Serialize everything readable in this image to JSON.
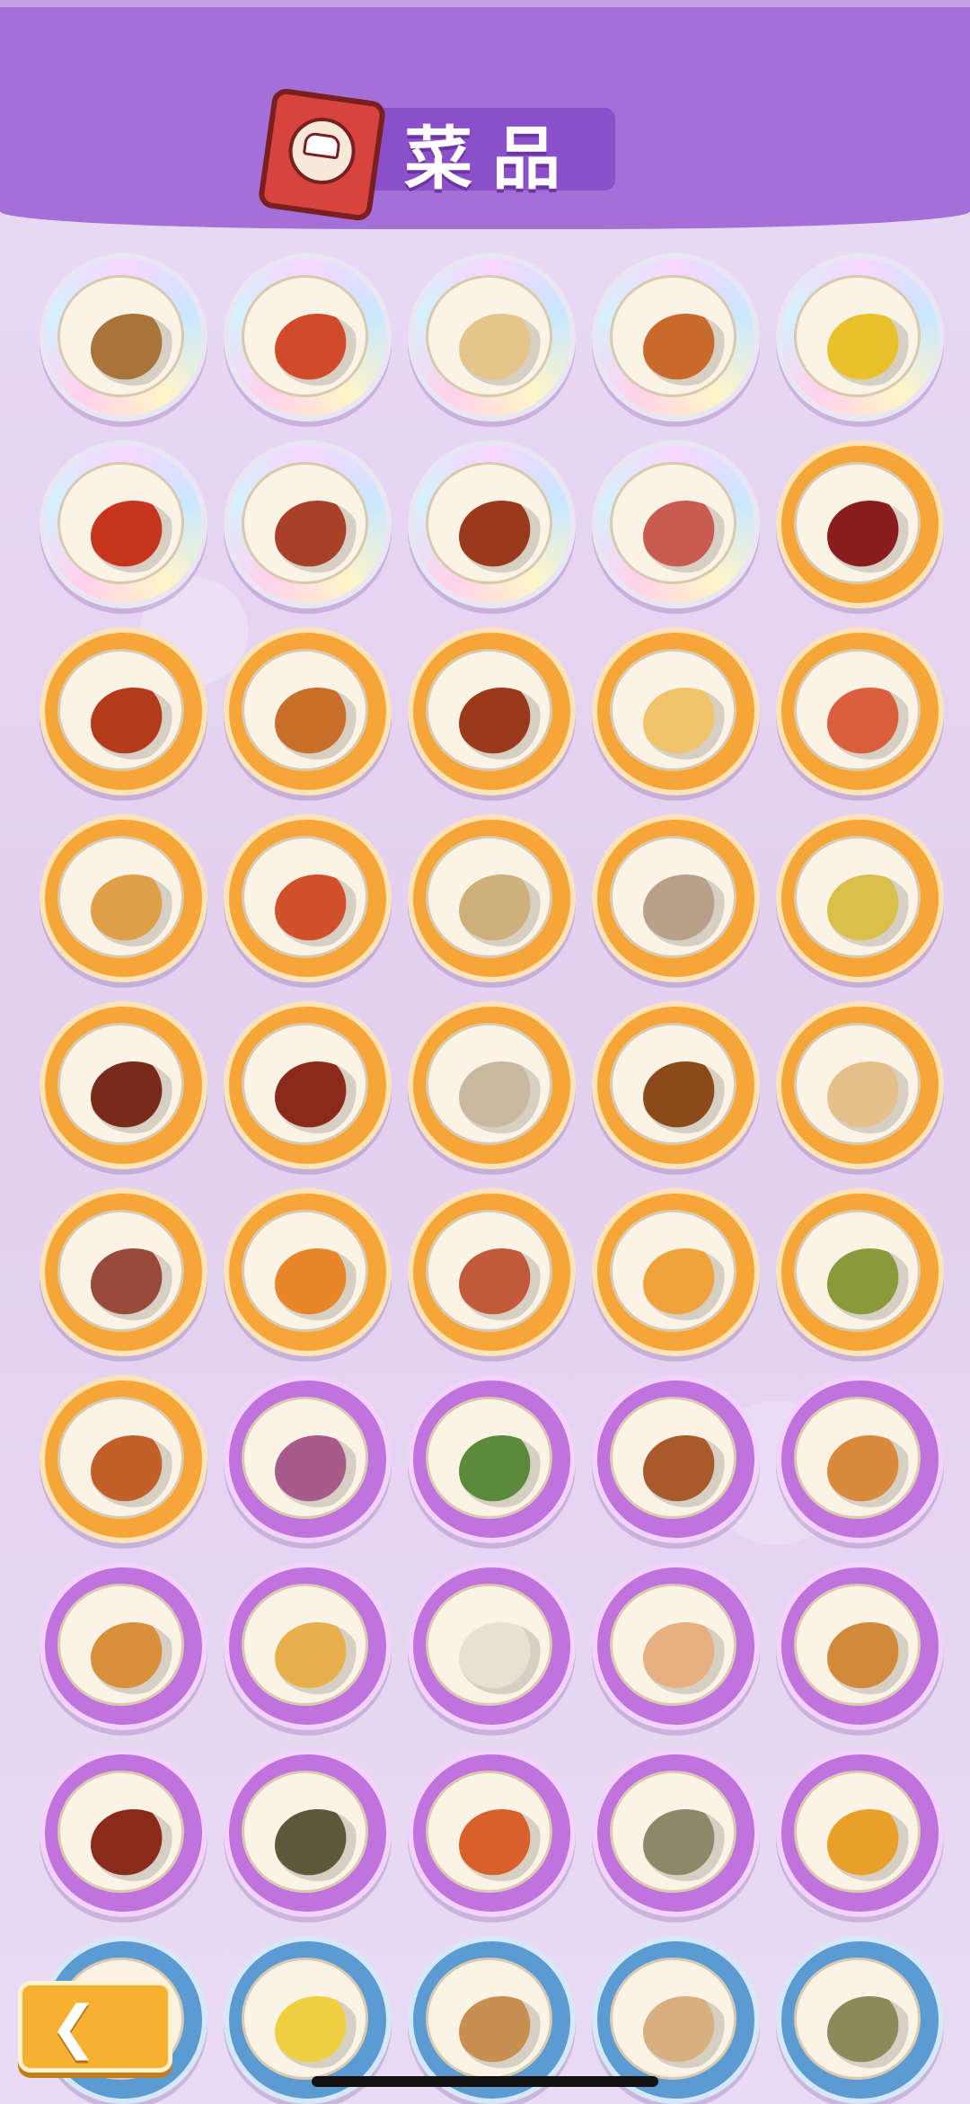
{
  "header": {
    "title": "菜品"
  },
  "colors": {
    "header_purple": "#a46fd6",
    "tier_gold": "#f6a637",
    "tier_purple": "#c072dd",
    "tier_blue": "#5b9bd1",
    "back_button": "#f6b132"
  },
  "dishes": [
    {
      "tier": "silver",
      "icon": "soup-jar-icon",
      "food": "#a8743a"
    },
    {
      "tier": "silver",
      "icon": "stir-fry-icon",
      "food": "#d14a2a"
    },
    {
      "tier": "silver",
      "icon": "fried-rice-icon",
      "food": "#e6c58a"
    },
    {
      "tier": "silver",
      "icon": "noodle-dish-icon",
      "food": "#c86a2a"
    },
    {
      "tier": "silver",
      "icon": "egg-custard-icon",
      "food": "#e9c12a"
    },
    {
      "tier": "silver",
      "icon": "crayfish-icon",
      "food": "#c8351f"
    },
    {
      "tier": "silver",
      "icon": "braised-fish-icon",
      "food": "#a8402a"
    },
    {
      "tier": "silver",
      "icon": "braised-meat-icon",
      "food": "#9a3a1c"
    },
    {
      "tier": "silver",
      "icon": "sausage-egg-icon",
      "food": "#c85a50"
    },
    {
      "tier": "gold",
      "icon": "braised-pork-icon",
      "food": "#8a1e1e"
    },
    {
      "tier": "gold",
      "icon": "pepper-beef-icon",
      "food": "#b33a1a"
    },
    {
      "tier": "gold",
      "icon": "kung-pao-icon",
      "food": "#c8702a"
    },
    {
      "tier": "gold",
      "icon": "clay-pot-icon",
      "food": "#9a3a1a"
    },
    {
      "tier": "gold",
      "icon": "shrimp-egg-icon",
      "food": "#f0c46a"
    },
    {
      "tier": "gold",
      "icon": "fish-head-icon",
      "food": "#d9603a"
    },
    {
      "tier": "gold",
      "icon": "noodle-bowl-icon",
      "food": "#e0a04a"
    },
    {
      "tier": "gold",
      "icon": "mapo-tofu-icon",
      "food": "#d0502a"
    },
    {
      "tier": "gold",
      "icon": "coconut-soup-icon",
      "food": "#cfb07a"
    },
    {
      "tier": "gold",
      "icon": "meatball-icon",
      "food": "#b8a08a"
    },
    {
      "tier": "gold",
      "icon": "cabbage-icon",
      "food": "#d9c04a"
    },
    {
      "tier": "gold",
      "icon": "green-pepper-icon",
      "food": "#7a2a1a"
    },
    {
      "tier": "gold",
      "icon": "tofu-stew-icon",
      "food": "#8a2a1a"
    },
    {
      "tier": "gold",
      "icon": "fish-soup-icon",
      "food": "#c8b8a0"
    },
    {
      "tier": "gold",
      "icon": "braised-chicken-icon",
      "food": "#8a4a1a"
    },
    {
      "tier": "gold",
      "icon": "chili-rice-icon",
      "food": "#e6c08a"
    },
    {
      "tier": "gold",
      "icon": "sliced-beef-icon",
      "food": "#9a4a3a"
    },
    {
      "tier": "gold",
      "icon": "egg-yolk-icon",
      "food": "#e8862a"
    },
    {
      "tier": "gold",
      "icon": "roast-duck-icon",
      "food": "#c25a3a"
    },
    {
      "tier": "gold",
      "icon": "crab-pastry-icon",
      "food": "#f2a23a"
    },
    {
      "tier": "gold",
      "icon": "bean-soup-icon",
      "food": "#8a9a3a"
    },
    {
      "tier": "gold",
      "icon": "roast-meat-icon",
      "food": "#c2602a"
    },
    {
      "tier": "purple",
      "icon": "eggplant-icon",
      "food": "#a85a8a"
    },
    {
      "tier": "purple",
      "icon": "greens-icon",
      "food": "#5a8a3a"
    },
    {
      "tier": "purple",
      "icon": "braised-tofu-icon",
      "food": "#a85a2a"
    },
    {
      "tier": "purple",
      "icon": "skewer-icon",
      "food": "#d98a3a"
    },
    {
      "tier": "purple",
      "icon": "fried-chicken-icon",
      "food": "#d8903a"
    },
    {
      "tier": "purple",
      "icon": "steamed-egg-icon",
      "food": "#e8b04a"
    },
    {
      "tier": "purple",
      "icon": "dumpling-icon",
      "food": "#e8e0d0"
    },
    {
      "tier": "purple",
      "icon": "egg-noodle-icon",
      "food": "#e8b080"
    },
    {
      "tier": "purple",
      "icon": "burger-icon",
      "food": "#d08a3a"
    },
    {
      "tier": "purple",
      "icon": "red-bean-icon",
      "food": "#8a2a1a"
    },
    {
      "tier": "purple",
      "icon": "mushroom-icon",
      "food": "#5a5a3a"
    },
    {
      "tier": "purple",
      "icon": "spicy-noodle-icon",
      "food": "#d8602a"
    },
    {
      "tier": "purple",
      "icon": "oyster-icon",
      "food": "#8a8a6a"
    },
    {
      "tier": "purple",
      "icon": "lemon-tea-icon",
      "food": "#e8a02a"
    },
    {
      "tier": "blue",
      "icon": "potato-shreds-icon",
      "food": "#c8b060"
    },
    {
      "tier": "blue",
      "icon": "scrambled-egg-icon",
      "food": "#f0d040"
    },
    {
      "tier": "blue",
      "icon": "egg-bowl-icon",
      "food": "#c89050"
    },
    {
      "tier": "blue",
      "icon": "fried-egg-noodle-icon",
      "food": "#d8b080"
    },
    {
      "tier": "blue",
      "icon": "herb-noodle-icon",
      "food": "#8a8a5a"
    }
  ],
  "back_button": {
    "icon": "chevron-left-icon",
    "glyph": "❮"
  }
}
